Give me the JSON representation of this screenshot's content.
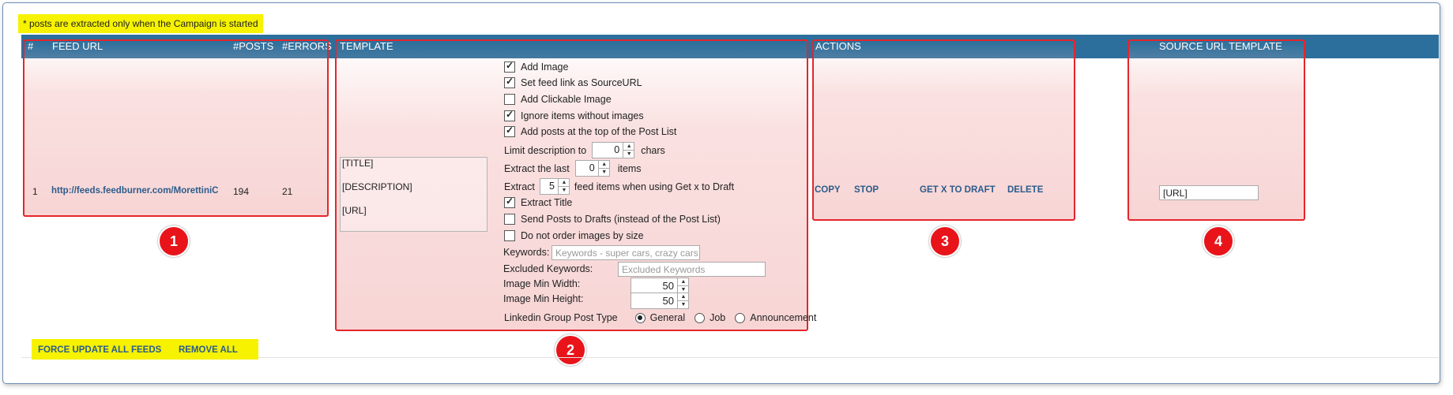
{
  "note": "* posts are extracted only when the Campaign is started",
  "columns": {
    "hash": "#",
    "feed_url": "FEED URL",
    "posts": "#POSTS",
    "errors": "#ERRORS",
    "template": "TEMPLATE",
    "actions": "ACTIONS",
    "source_url_template": "SOURCE URL TEMPLATE"
  },
  "row": {
    "index": "1",
    "feed_url": "http://feeds.feedburner.com/MorettiniC",
    "posts": "194",
    "errors": "21",
    "template_lines": [
      "[TITLE]",
      "[DESCRIPTION]",
      "[URL]"
    ],
    "source_url_template": "[URL]"
  },
  "options": {
    "add_image": {
      "label": "Add Image",
      "checked": true
    },
    "set_feed_link": {
      "label": "Set feed link as SourceURL",
      "checked": true
    },
    "add_clickable_image": {
      "label": "Add Clickable Image",
      "checked": false
    },
    "ignore_no_images": {
      "label": "Ignore items without images",
      "checked": true
    },
    "add_posts_top": {
      "label": "Add posts at the top of the Post List",
      "checked": true
    },
    "limit_description": {
      "label": "Limit description to",
      "value": "0",
      "suffix": "chars"
    },
    "extract_last": {
      "label": "Extract the last",
      "value": "0",
      "suffix": "items"
    },
    "extract_getx": {
      "label": "Extract",
      "value": "5",
      "suffix": "feed items when using Get x to Draft"
    },
    "extract_title": {
      "label": "Extract Title",
      "checked": true
    },
    "send_to_drafts": {
      "label": "Send Posts to Drafts (instead of the Post List)",
      "checked": false
    },
    "no_order_images": {
      "label": "Do not order images by size",
      "checked": false
    },
    "keywords": {
      "label": "Keywords:",
      "placeholder": "Keywords - super cars, crazy cars"
    },
    "excluded_keywords": {
      "label": "Excluded Keywords:",
      "placeholder": "Excluded Keywords"
    },
    "image_min_width": {
      "label": "Image Min Width:",
      "value": "50"
    },
    "image_min_height": {
      "label": "Image Min Height:",
      "value": "50"
    },
    "linkedin_type": {
      "label": "Linkedin Group Post Type",
      "choices": [
        "General",
        "Job",
        "Announcement"
      ],
      "selected": "General"
    }
  },
  "actions": [
    "COPY",
    "STOP",
    "GET X TO DRAFT",
    "DELETE"
  ],
  "bottom_actions": [
    "FORCE UPDATE ALL FEEDS",
    "REMOVE ALL"
  ],
  "badges": [
    "1",
    "2",
    "3",
    "4"
  ],
  "colors": {
    "header": "#2c6f9c",
    "highlight": "#f6f200",
    "callout": "#e3262b",
    "link": "#2b5c8c"
  }
}
